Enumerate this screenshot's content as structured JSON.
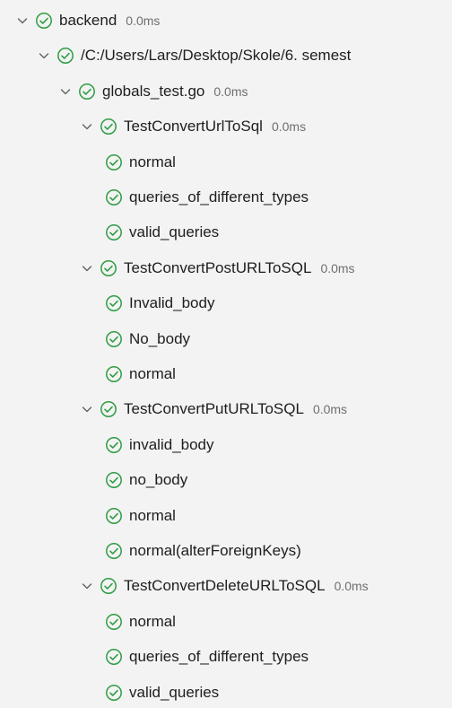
{
  "colors": {
    "pass": "#2e9d44",
    "chevron": "#616161",
    "text": "#1e1e1e",
    "duration": "#6f6f6f",
    "background": "#f3f3f3"
  },
  "icons": {
    "chevron": "chevron-down-icon",
    "status": "pass-check-icon"
  },
  "tree": [
    {
      "label": "backend",
      "duration": "0.0ms",
      "depth": 0,
      "expandable": true,
      "status": "passed"
    },
    {
      "label": "/C:/Users/Lars/Desktop/Skole/6. semest",
      "duration": "",
      "depth": 1,
      "expandable": true,
      "status": "passed"
    },
    {
      "label": "globals_test.go",
      "duration": "0.0ms",
      "depth": 2,
      "expandable": true,
      "status": "passed"
    },
    {
      "label": "TestConvertUrlToSql",
      "duration": "0.0ms",
      "depth": 3,
      "expandable": true,
      "status": "passed"
    },
    {
      "label": "normal",
      "duration": "",
      "depth": 4,
      "expandable": false,
      "status": "passed"
    },
    {
      "label": "queries_of_different_types",
      "duration": "",
      "depth": 4,
      "expandable": false,
      "status": "passed"
    },
    {
      "label": "valid_queries",
      "duration": "",
      "depth": 4,
      "expandable": false,
      "status": "passed"
    },
    {
      "label": "TestConvertPostURLToSQL",
      "duration": "0.0ms",
      "depth": 3,
      "expandable": true,
      "status": "passed"
    },
    {
      "label": "Invalid_body",
      "duration": "",
      "depth": 4,
      "expandable": false,
      "status": "passed"
    },
    {
      "label": "No_body",
      "duration": "",
      "depth": 4,
      "expandable": false,
      "status": "passed"
    },
    {
      "label": "normal",
      "duration": "",
      "depth": 4,
      "expandable": false,
      "status": "passed"
    },
    {
      "label": "TestConvertPutURLToSQL",
      "duration": "0.0ms",
      "depth": 3,
      "expandable": true,
      "status": "passed"
    },
    {
      "label": "invalid_body",
      "duration": "",
      "depth": 4,
      "expandable": false,
      "status": "passed"
    },
    {
      "label": "no_body",
      "duration": "",
      "depth": 4,
      "expandable": false,
      "status": "passed"
    },
    {
      "label": "normal",
      "duration": "",
      "depth": 4,
      "expandable": false,
      "status": "passed"
    },
    {
      "label": "normal(alterForeignKeys)",
      "duration": "",
      "depth": 4,
      "expandable": false,
      "status": "passed"
    },
    {
      "label": "TestConvertDeleteURLToSQL",
      "duration": "0.0ms",
      "depth": 3,
      "expandable": true,
      "status": "passed"
    },
    {
      "label": "normal",
      "duration": "",
      "depth": 4,
      "expandable": false,
      "status": "passed"
    },
    {
      "label": "queries_of_different_types",
      "duration": "",
      "depth": 4,
      "expandable": false,
      "status": "passed"
    },
    {
      "label": "valid_queries",
      "duration": "",
      "depth": 4,
      "expandable": false,
      "status": "passed"
    }
  ]
}
